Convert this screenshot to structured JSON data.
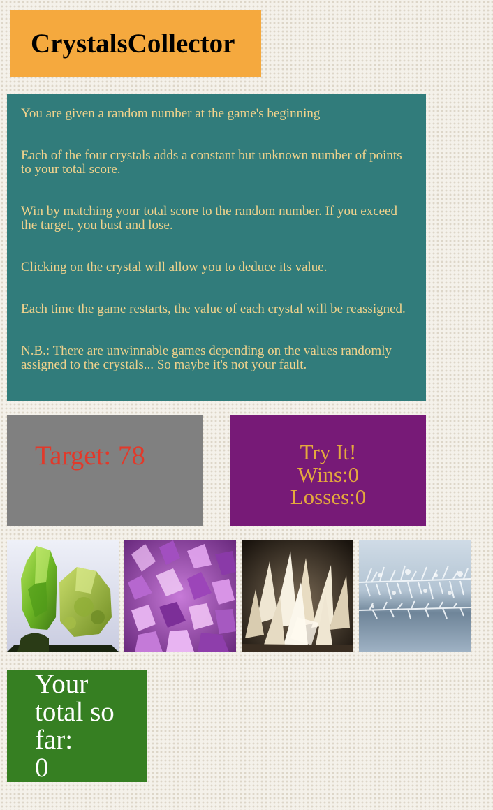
{
  "header": {
    "title": "CrystalsCollector"
  },
  "instructions": [
    "You are given a random number at the game's beginning",
    "Each of the four crystals adds a constant but unknown number of points to your total score.",
    "Win by matching your total score to the random number. If you exceed the target, you bust and lose.",
    "Clicking on the crystal will allow you to deduce its value.",
    "Each time the game restarts, the value of each crystal will be reassigned.",
    "N.B.: There are unwinnable games depending on the values randomly assigned to the crystals... So maybe it's not your fault."
  ],
  "target": {
    "text": "Target: 78"
  },
  "scoreboard": {
    "status": "Try It!",
    "wins": "Wins:0",
    "losses": "Losses:0"
  },
  "crystals": [
    {
      "icon": "green-peridot-crystal-icon"
    },
    {
      "icon": "purple-amethyst-crystal-icon"
    },
    {
      "icon": "white-quartz-crystal-icon"
    },
    {
      "icon": "blue-frost-crystal-icon"
    }
  ],
  "total": {
    "label": "Your total so far:",
    "value": "0"
  },
  "colors": {
    "header_bg": "#f5a93e",
    "instructions_bg": "#317c7b",
    "instructions_text": "#efd28c",
    "target_bg": "#808080",
    "target_text": "#e2392a",
    "score_bg": "#771a77",
    "score_text": "#e4a93d",
    "total_bg": "#367f22"
  }
}
